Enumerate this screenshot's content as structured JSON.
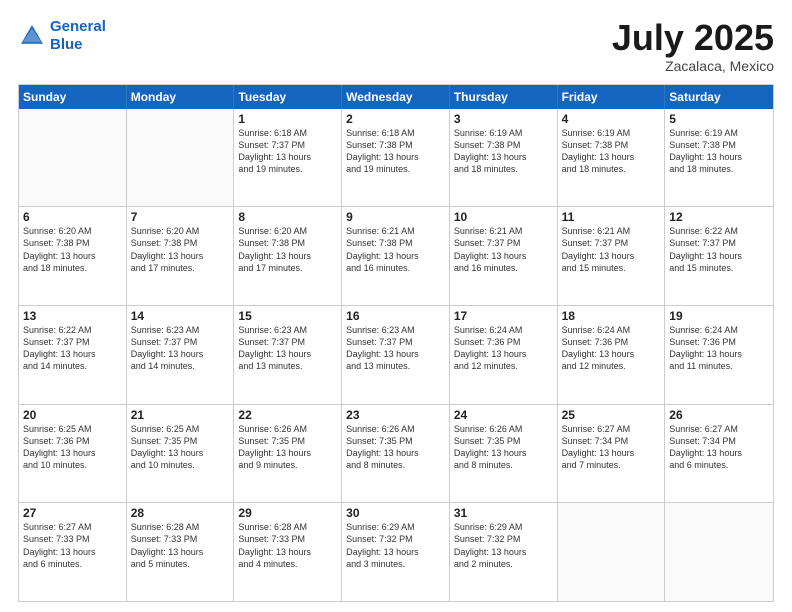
{
  "header": {
    "logo_line1": "General",
    "logo_line2": "Blue",
    "month": "July 2025",
    "location": "Zacalaca, Mexico"
  },
  "weekdays": [
    "Sunday",
    "Monday",
    "Tuesday",
    "Wednesday",
    "Thursday",
    "Friday",
    "Saturday"
  ],
  "rows": [
    [
      {
        "day": "",
        "detail": ""
      },
      {
        "day": "",
        "detail": ""
      },
      {
        "day": "1",
        "detail": "Sunrise: 6:18 AM\nSunset: 7:37 PM\nDaylight: 13 hours\nand 19 minutes."
      },
      {
        "day": "2",
        "detail": "Sunrise: 6:18 AM\nSunset: 7:38 PM\nDaylight: 13 hours\nand 19 minutes."
      },
      {
        "day": "3",
        "detail": "Sunrise: 6:19 AM\nSunset: 7:38 PM\nDaylight: 13 hours\nand 18 minutes."
      },
      {
        "day": "4",
        "detail": "Sunrise: 6:19 AM\nSunset: 7:38 PM\nDaylight: 13 hours\nand 18 minutes."
      },
      {
        "day": "5",
        "detail": "Sunrise: 6:19 AM\nSunset: 7:38 PM\nDaylight: 13 hours\nand 18 minutes."
      }
    ],
    [
      {
        "day": "6",
        "detail": "Sunrise: 6:20 AM\nSunset: 7:38 PM\nDaylight: 13 hours\nand 18 minutes."
      },
      {
        "day": "7",
        "detail": "Sunrise: 6:20 AM\nSunset: 7:38 PM\nDaylight: 13 hours\nand 17 minutes."
      },
      {
        "day": "8",
        "detail": "Sunrise: 6:20 AM\nSunset: 7:38 PM\nDaylight: 13 hours\nand 17 minutes."
      },
      {
        "day": "9",
        "detail": "Sunrise: 6:21 AM\nSunset: 7:38 PM\nDaylight: 13 hours\nand 16 minutes."
      },
      {
        "day": "10",
        "detail": "Sunrise: 6:21 AM\nSunset: 7:37 PM\nDaylight: 13 hours\nand 16 minutes."
      },
      {
        "day": "11",
        "detail": "Sunrise: 6:21 AM\nSunset: 7:37 PM\nDaylight: 13 hours\nand 15 minutes."
      },
      {
        "day": "12",
        "detail": "Sunrise: 6:22 AM\nSunset: 7:37 PM\nDaylight: 13 hours\nand 15 minutes."
      }
    ],
    [
      {
        "day": "13",
        "detail": "Sunrise: 6:22 AM\nSunset: 7:37 PM\nDaylight: 13 hours\nand 14 minutes."
      },
      {
        "day": "14",
        "detail": "Sunrise: 6:23 AM\nSunset: 7:37 PM\nDaylight: 13 hours\nand 14 minutes."
      },
      {
        "day": "15",
        "detail": "Sunrise: 6:23 AM\nSunset: 7:37 PM\nDaylight: 13 hours\nand 13 minutes."
      },
      {
        "day": "16",
        "detail": "Sunrise: 6:23 AM\nSunset: 7:37 PM\nDaylight: 13 hours\nand 13 minutes."
      },
      {
        "day": "17",
        "detail": "Sunrise: 6:24 AM\nSunset: 7:36 PM\nDaylight: 13 hours\nand 12 minutes."
      },
      {
        "day": "18",
        "detail": "Sunrise: 6:24 AM\nSunset: 7:36 PM\nDaylight: 13 hours\nand 12 minutes."
      },
      {
        "day": "19",
        "detail": "Sunrise: 6:24 AM\nSunset: 7:36 PM\nDaylight: 13 hours\nand 11 minutes."
      }
    ],
    [
      {
        "day": "20",
        "detail": "Sunrise: 6:25 AM\nSunset: 7:36 PM\nDaylight: 13 hours\nand 10 minutes."
      },
      {
        "day": "21",
        "detail": "Sunrise: 6:25 AM\nSunset: 7:35 PM\nDaylight: 13 hours\nand 10 minutes."
      },
      {
        "day": "22",
        "detail": "Sunrise: 6:26 AM\nSunset: 7:35 PM\nDaylight: 13 hours\nand 9 minutes."
      },
      {
        "day": "23",
        "detail": "Sunrise: 6:26 AM\nSunset: 7:35 PM\nDaylight: 13 hours\nand 8 minutes."
      },
      {
        "day": "24",
        "detail": "Sunrise: 6:26 AM\nSunset: 7:35 PM\nDaylight: 13 hours\nand 8 minutes."
      },
      {
        "day": "25",
        "detail": "Sunrise: 6:27 AM\nSunset: 7:34 PM\nDaylight: 13 hours\nand 7 minutes."
      },
      {
        "day": "26",
        "detail": "Sunrise: 6:27 AM\nSunset: 7:34 PM\nDaylight: 13 hours\nand 6 minutes."
      }
    ],
    [
      {
        "day": "27",
        "detail": "Sunrise: 6:27 AM\nSunset: 7:33 PM\nDaylight: 13 hours\nand 6 minutes."
      },
      {
        "day": "28",
        "detail": "Sunrise: 6:28 AM\nSunset: 7:33 PM\nDaylight: 13 hours\nand 5 minutes."
      },
      {
        "day": "29",
        "detail": "Sunrise: 6:28 AM\nSunset: 7:33 PM\nDaylight: 13 hours\nand 4 minutes."
      },
      {
        "day": "30",
        "detail": "Sunrise: 6:29 AM\nSunset: 7:32 PM\nDaylight: 13 hours\nand 3 minutes."
      },
      {
        "day": "31",
        "detail": "Sunrise: 6:29 AM\nSunset: 7:32 PM\nDaylight: 13 hours\nand 2 minutes."
      },
      {
        "day": "",
        "detail": ""
      },
      {
        "day": "",
        "detail": ""
      }
    ]
  ]
}
